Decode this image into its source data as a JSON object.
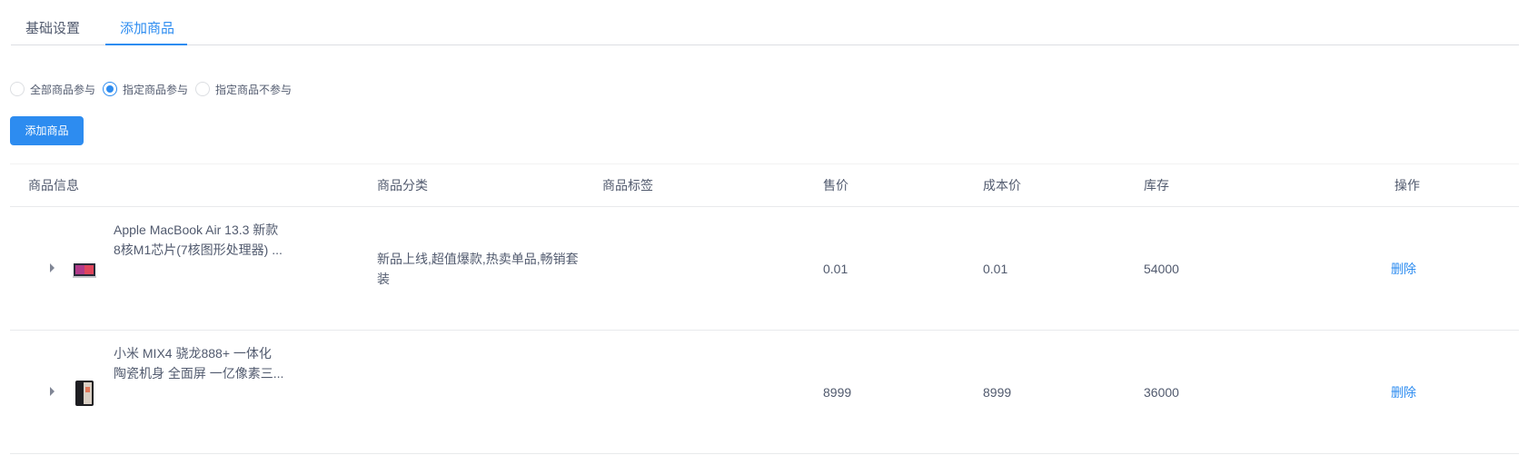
{
  "tabs": [
    {
      "label": "基础设置",
      "active": false
    },
    {
      "label": "添加商品",
      "active": true
    }
  ],
  "scope_options": [
    {
      "label": "全部商品参与",
      "checked": false
    },
    {
      "label": "指定商品参与",
      "checked": true
    },
    {
      "label": "指定商品不参与",
      "checked": false
    }
  ],
  "add_button_label": "添加商品",
  "table": {
    "headers": {
      "info": "商品信息",
      "category": "商品分类",
      "tags": "商品标签",
      "price": "售价",
      "cost": "成本价",
      "stock": "库存",
      "action": "操作"
    },
    "rows": [
      {
        "name_line1": "Apple MacBook Air 13.3 新款",
        "name_line2": "8核M1芯片(7核图形处理器) ...",
        "category": "新品上线,超值爆款,热卖单品,畅销套装",
        "tags": "",
        "price": "0.01",
        "cost": "0.01",
        "stock": "54000",
        "action": "删除",
        "thumb_icon": "laptop-icon"
      },
      {
        "name_line1": "小米 MIX4 骁龙888+ 一体化",
        "name_line2": "陶瓷机身 全面屏 一亿像素三...",
        "category": "",
        "tags": "",
        "price": "8999",
        "cost": "8999",
        "stock": "36000",
        "action": "删除",
        "thumb_icon": "phone-icon"
      }
    ]
  },
  "colors": {
    "accent": "#2d8cf0",
    "text": "#515a6e",
    "border": "#e8eaec"
  }
}
